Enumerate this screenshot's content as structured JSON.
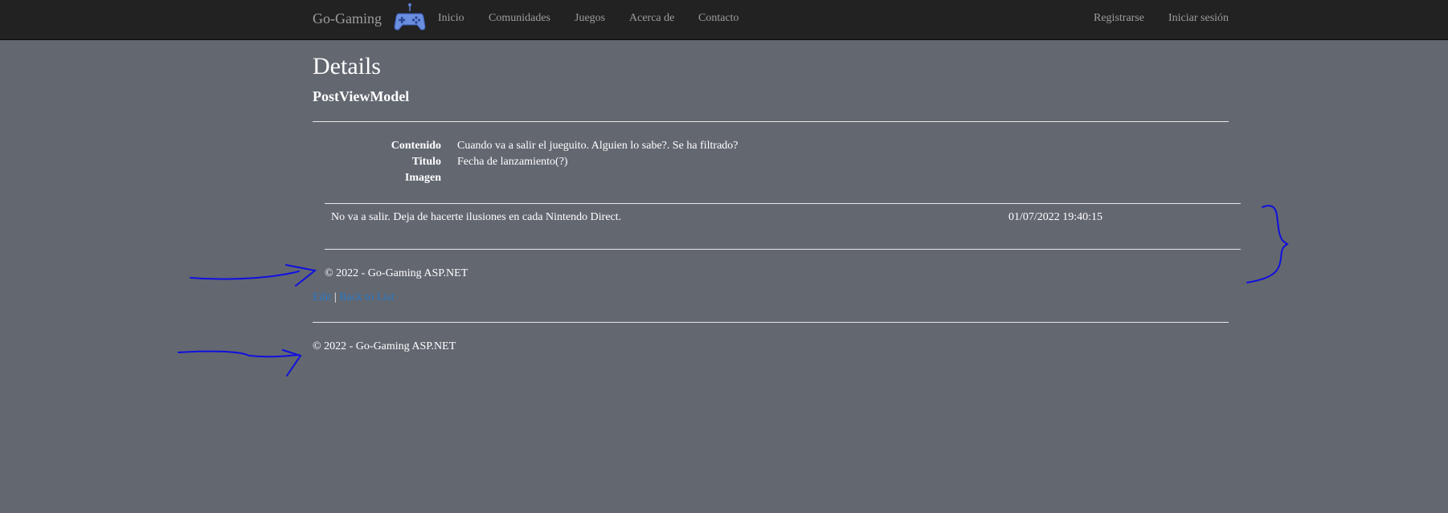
{
  "navbar": {
    "brand": "Go-Gaming",
    "logo_icon": "gamepad-icon",
    "links": [
      "Inicio",
      "Comunidades",
      "Juegos",
      "Acerca de",
      "Contacto"
    ],
    "right_links": [
      "Registrarse",
      "Iniciar sesión"
    ]
  },
  "page": {
    "title": "Details",
    "subtitle": "PostViewModel"
  },
  "details": [
    {
      "term": "Contenido",
      "value": "Cuando va a salir el jueguito. Alguien lo sabe?. Se ha filtrado?"
    },
    {
      "term": "Titulo",
      "value": "Fecha de lanzamiento(?)"
    },
    {
      "term": "Imagen",
      "value": ""
    }
  ],
  "comment": {
    "text": "No va a salir. Deja de hacerte ilusiones en cada Nintendo Direct.",
    "date": "01/07/2022 19:40:15"
  },
  "inner_footer": "© 2022 - Go-Gaming ASP.NET",
  "actions": {
    "edit": "Edit",
    "separator": "|",
    "back": "Back to List"
  },
  "footer": "© 2022 - Go-Gaming ASP.NET",
  "colors": {
    "background": "#636770",
    "navbar": "#222222",
    "link": "#2a7ac6",
    "annotation": "#0000ee"
  }
}
